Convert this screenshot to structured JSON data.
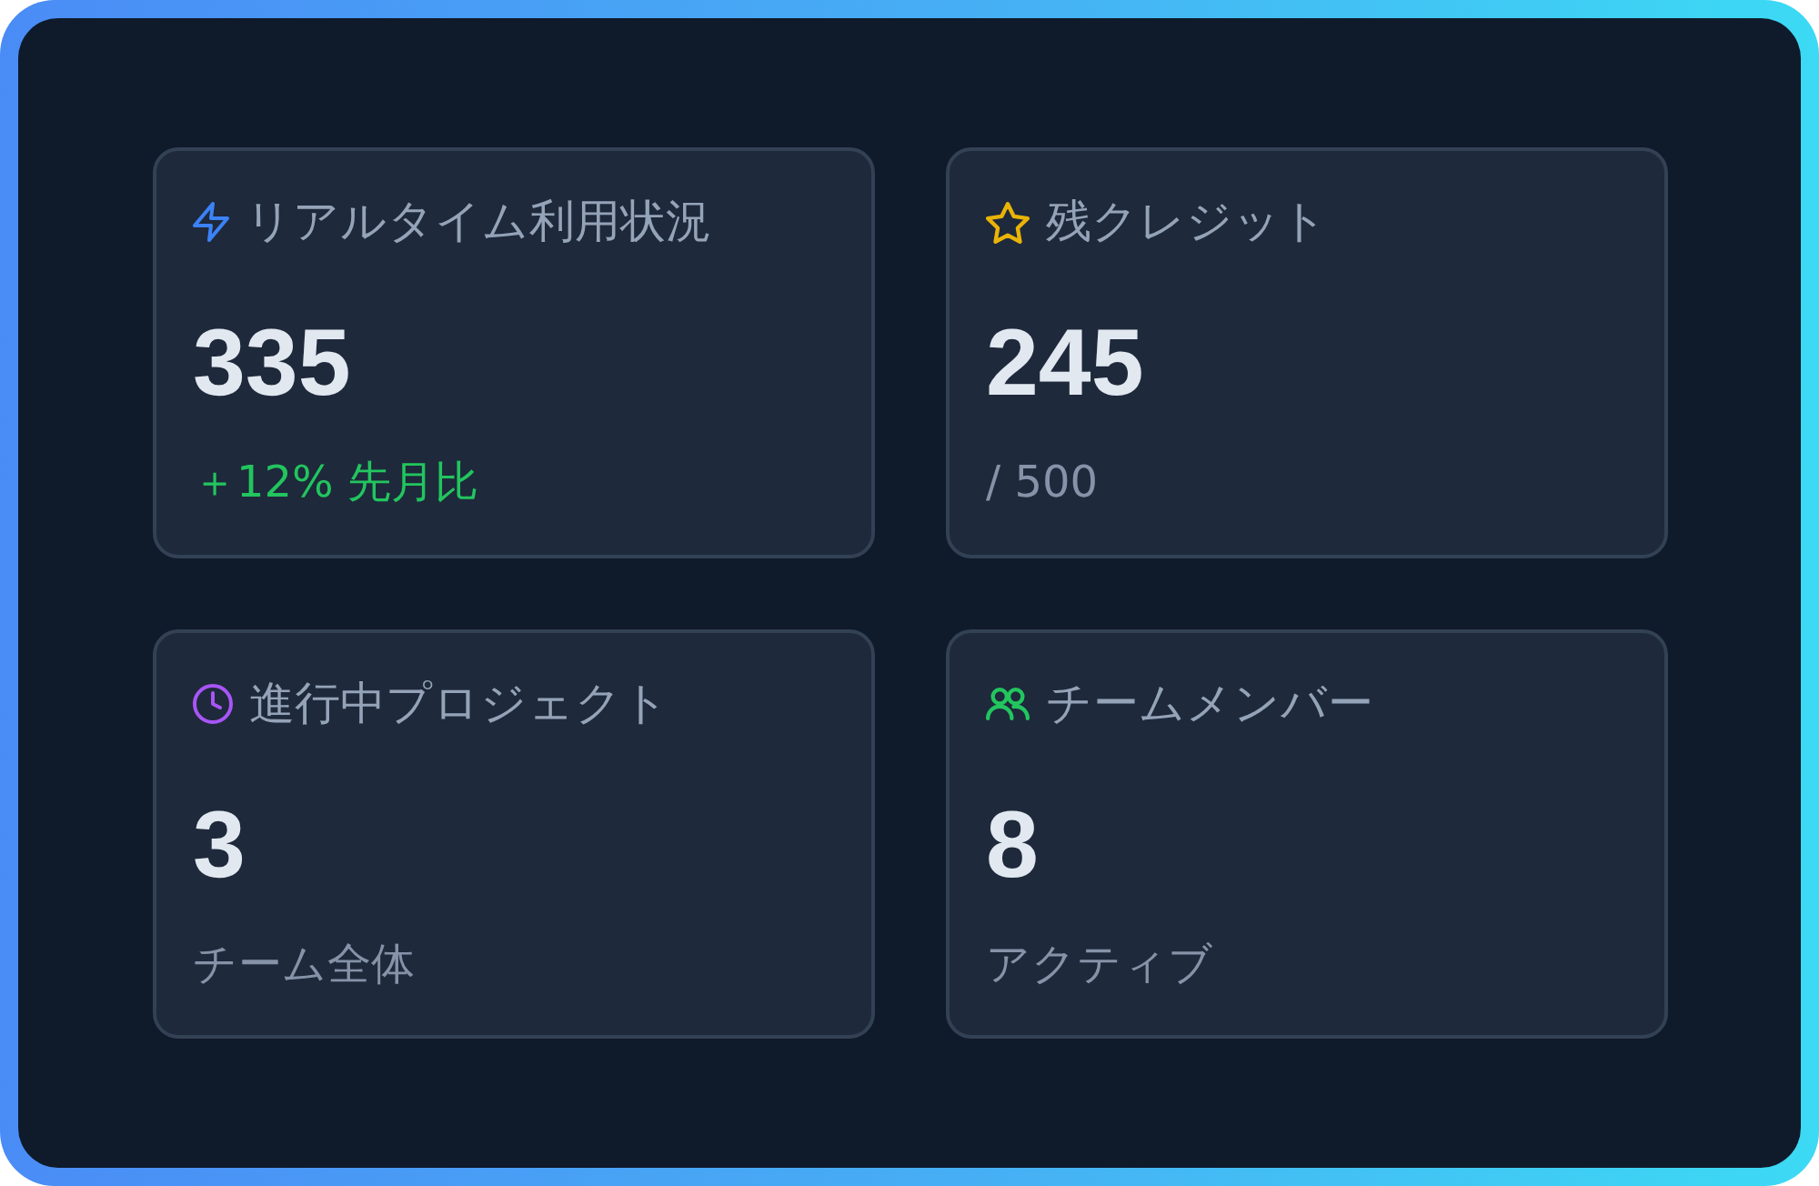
{
  "cards": [
    {
      "kind": "usage",
      "color": "#3b82f6",
      "title": "リアルタイム利用状況",
      "value": "335",
      "note": {
        "text": "＋12% 先月比",
        "positive": true
      }
    },
    {
      "kind": "credits",
      "color": "#eab308",
      "title": "残クレジット",
      "value": "245",
      "note": {
        "text": "/ 500",
        "positive": false
      }
    },
    {
      "kind": "projects",
      "color": "#a855f7",
      "title": "進行中プロジェクト",
      "value": "3",
      "note": {
        "text": "チーム全体",
        "positive": false
      }
    },
    {
      "kind": "members",
      "color": "#22c55e",
      "title": "チームメンバー",
      "value": "8",
      "note": {
        "text": "アクティブ",
        "positive": false
      }
    }
  ]
}
